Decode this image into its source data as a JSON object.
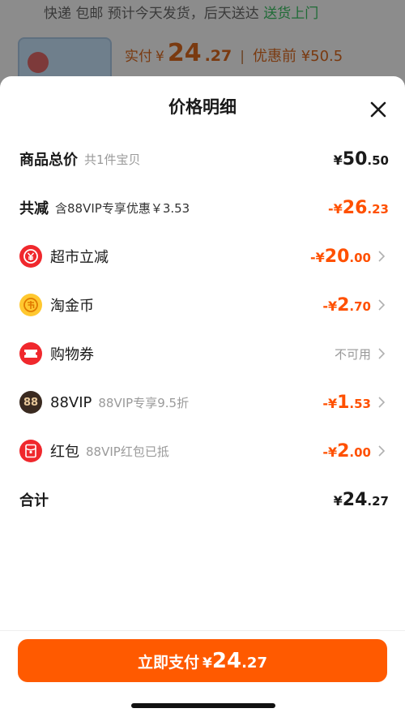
{
  "background": {
    "shipping_prefix": "快递 包邮 预计今天发货，后天送达",
    "shipping_highlight": "送货上门",
    "paid_label": "实付",
    "paid_currency": "¥",
    "paid_int": "24",
    "paid_dec": ".27",
    "separator": "|",
    "original_label": "优惠前 ¥50.5"
  },
  "sheet": {
    "title": "价格明细",
    "rows": {
      "total": {
        "label": "商品总价",
        "sub": "共1件宝贝",
        "currency": "¥",
        "int": "50",
        "dec": ".50"
      },
      "discount": {
        "label": "共减",
        "sub": "含88VIP专享优惠￥3.53",
        "currency": "-¥",
        "int": "26",
        "dec": ".23"
      },
      "supermarket": {
        "label": "超市立减",
        "currency": "-¥",
        "int": "20",
        "dec": ".00"
      },
      "coins": {
        "label": "淘金币",
        "currency": "-¥",
        "int": "2",
        "dec": ".70"
      },
      "coupon": {
        "label": "购物券",
        "value": "不可用"
      },
      "vip": {
        "label": "88VIP",
        "sub": "88VIP专享9.5折",
        "icon_text": "88",
        "currency": "-¥",
        "int": "1",
        "dec": ".53"
      },
      "redpacket": {
        "label": "红包",
        "sub": "88VIP红包已抵",
        "currency": "-¥",
        "int": "2",
        "dec": ".00"
      },
      "sum": {
        "label": "合计",
        "currency": "¥",
        "int": "24",
        "dec": ".27"
      }
    }
  },
  "pay_button": {
    "label": "立即支付",
    "currency": "¥",
    "int": "24",
    "dec": ".27"
  },
  "colors": {
    "accent": "#ff5000",
    "button": "#ff5a00",
    "icon_red": "#f0282d",
    "icon_gold": "#ffc830",
    "icon_dark": "#3a2a20"
  },
  "icons": {
    "close": "close-icon",
    "supermarket": "yuan-badge-icon",
    "coins": "gold-coin-icon",
    "coupon": "ticket-icon",
    "vip": "vip-88-icon",
    "redpacket": "red-envelope-icon",
    "chevron": "chevron-right-icon"
  }
}
